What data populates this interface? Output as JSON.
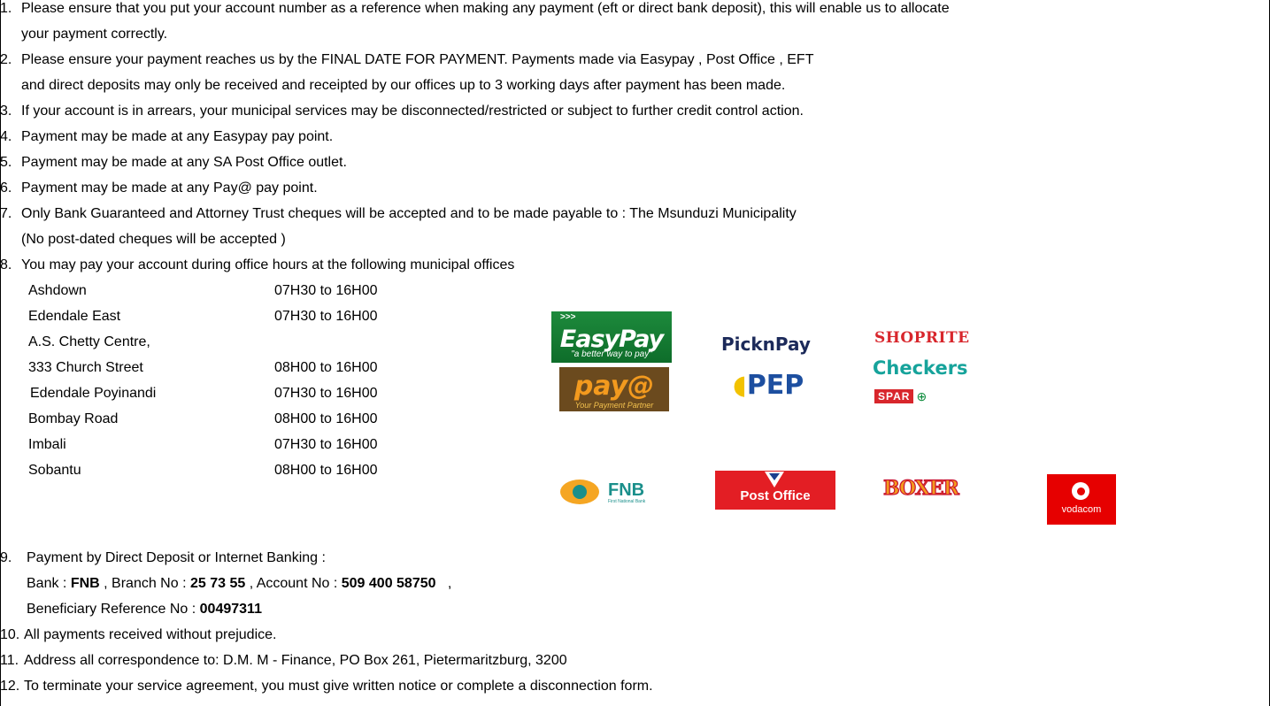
{
  "items": [
    {
      "num": "1.",
      "lines": [
        "Please ensure that you put your account number as a reference when making any payment (eft or direct bank deposit), this will enable us to allocate",
        "your payment correctly."
      ]
    },
    {
      "num": "2.",
      "lines": [
        "Please ensure your payment reaches us by the FINAL DATE FOR PAYMENT. Payments made via Easypay , Post Office , EFT",
        "and direct deposits may only be received and receipted by our offices up to 3 working days after payment has been made."
      ]
    },
    {
      "num": "3.",
      "lines": [
        "If your account is in arrears, your municipal services may be disconnected/restricted or subject to further credit control action."
      ]
    },
    {
      "num": "4.",
      "lines": [
        "Payment may be made at any Easypay pay point."
      ]
    },
    {
      "num": "5.",
      "lines": [
        "Payment may be made at any SA Post Office outlet."
      ]
    },
    {
      "num": "6.",
      "lines": [
        "Payment may be made at any Pay@ pay point."
      ]
    },
    {
      "num": "7.",
      "lines": [
        "Only Bank Guaranteed and Attorney Trust cheques will  be accepted and to be made payable to : The Msunduzi Municipality",
        "(No post-dated cheques will be accepted )"
      ]
    },
    {
      "num": "8.",
      "lines": [
        "You may pay your account during office hours at the following municipal offices"
      ]
    },
    {
      "num": "9.",
      "lines": [
        "Payment by Direct Deposit or Internet Banking :"
      ]
    },
    {
      "num": "10.",
      "lines": [
        "All payments received without prejudice."
      ]
    },
    {
      "num": "11.",
      "lines": [
        "Address all correspondence to: D.M. M - Finance, PO Box 261, Pietermaritzburg, 3200"
      ]
    },
    {
      "num": "12.",
      "lines": [
        "To terminate your service agreement, you must give written notice or complete a disconnection form."
      ]
    }
  ],
  "offices": [
    {
      "name": "Ashdown",
      "hours": "07H30 to 16H00"
    },
    {
      "name": "Edendale East",
      "hours": "07H30 to 16H00"
    },
    {
      "name": "A.S. Chetty Centre,",
      "hours": ""
    },
    {
      "name": "333 Church Street",
      "hours": "08H00 to 16H00"
    },
    {
      "name": "Edendale Poyinandi",
      "hours": "07H30 to 16H00"
    },
    {
      "name": "Bombay Road",
      "hours": "08H00 to 16H00"
    },
    {
      "name": "Imbali",
      "hours": "07H30 to 16H00"
    },
    {
      "name": "Sobantu",
      "hours": "08H00 to 16H00"
    }
  ],
  "bank": {
    "bank_label": "Bank : ",
    "bank_value": "FNB",
    "branch_label": " , Branch No : ",
    "branch_value": "25 73 55",
    "account_label": " , Account No : ",
    "account_value": "509 400 58750",
    "account_tail": "   ,",
    "beneficiary_label": "Beneficiary Reference No : ",
    "beneficiary_value": "00497311"
  },
  "logos": {
    "easypay": {
      "word": "EasyPay",
      "tag": "\"a better way to pay\"",
      "chev": ">>>"
    },
    "payat": {
      "word": "pay@",
      "tag": "Your Payment Partner"
    },
    "picknpay": "PicknPay",
    "pep": "PEP",
    "shoprite": "SHOPRITE",
    "checkers": "Checkers",
    "spar": "SPAR",
    "fnb": {
      "word": "FNB",
      "small": "First National Bank"
    },
    "postoffice": "Post Office",
    "boxer": "BOXER",
    "vodacom": "vodacom"
  },
  "colors": {
    "easypay": "#1d8a3c",
    "payat": "#6b4a1e",
    "fnb": "#1a8f8b",
    "postoffice": "#e31e24",
    "vodacom": "#e60000",
    "shoprite": "#d8262c",
    "checkers": "#16a39b"
  }
}
